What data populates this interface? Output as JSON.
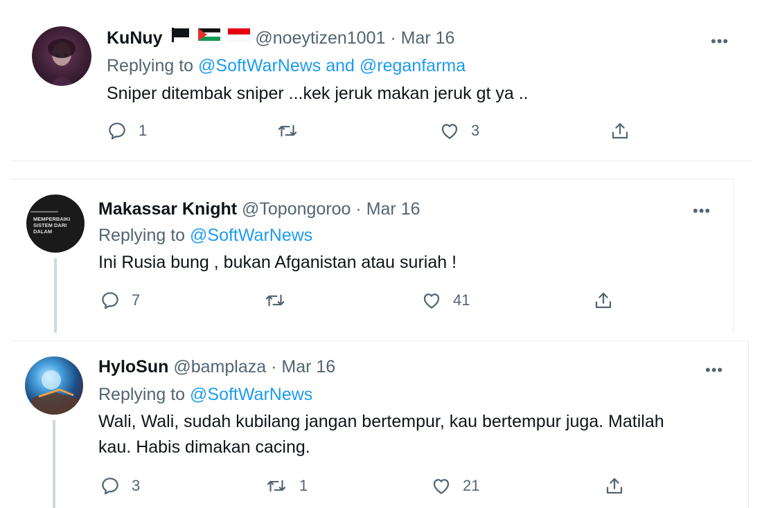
{
  "tweets": [
    {
      "display_name": "KuNuy",
      "handle": "@noeytizen1001",
      "separator": "·",
      "date": "Mar 16",
      "replying_prefix": "Replying to",
      "replying_to": "@SoftWarNews",
      "replying_join": "and",
      "replying_to_2": "@reganfarma",
      "text": "Sniper ditembak sniper ...kek jeruk makan jeruk gt ya ..",
      "replies": "1",
      "retweets": "",
      "likes": "3",
      "flags": [
        "black-flag-icon",
        "palestine-flag-icon",
        "indonesia-flag-icon"
      ]
    },
    {
      "display_name": "Makassar Knight",
      "handle": "@Topongoroo",
      "separator": "·",
      "date": "Mar 16",
      "replying_prefix": "Replying to",
      "replying_to": "@SoftWarNews",
      "text": "Ini Rusia bung , bukan Afganistan atau suriah !",
      "replies": "7",
      "retweets": "",
      "likes": "41",
      "avatar_text": "MEMPERBAIKI SISTEM DARI DALAM"
    },
    {
      "display_name": "HyloSun",
      "handle": "@bamplaza",
      "separator": "·",
      "date": "Mar 16",
      "replying_prefix": "Replying to",
      "replying_to": "@SoftWarNews",
      "text_line1": "Wali, Wali, sudah kubilang jangan bertempur, kau bertempur juga. Matilah",
      "text_line2": "kau. Habis dimakan cacing.",
      "replies": "3",
      "retweets": "1",
      "likes": "21"
    }
  ],
  "more_glyph": "•••",
  "colors": {
    "link": "#1d9bf0",
    "secondary": "#536471",
    "primary": "#0f1419",
    "thread_line": "#cfd9de"
  }
}
